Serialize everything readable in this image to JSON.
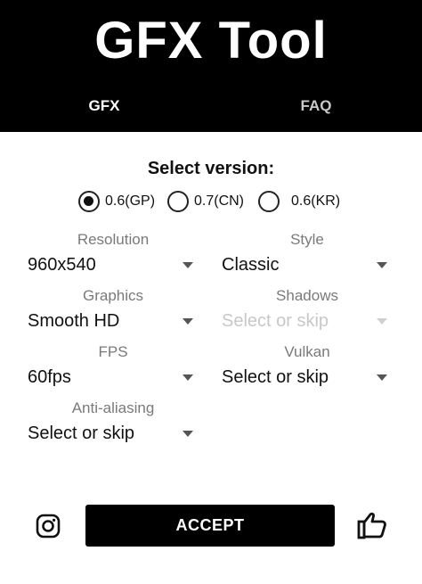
{
  "header": {
    "title": "GFX Tool",
    "tabs": [
      {
        "label": "GFX",
        "active": true
      },
      {
        "label": "FAQ",
        "active": false
      }
    ]
  },
  "version": {
    "heading": "Select version:",
    "options": [
      {
        "label": "0.6(GP)",
        "selected": true
      },
      {
        "label": "0.7(CN)",
        "selected": false
      },
      {
        "label": "0.6(KR)",
        "selected": false
      }
    ]
  },
  "settings": {
    "resolution": {
      "label": "Resolution",
      "value": "960x540"
    },
    "style": {
      "label": "Style",
      "value": "Classic"
    },
    "graphics": {
      "label": "Graphics",
      "value": "Smooth HD"
    },
    "shadows": {
      "label": "Shadows",
      "value": "Select or skip",
      "disabled": true
    },
    "fps": {
      "label": "FPS",
      "value": "60fps"
    },
    "vulkan": {
      "label": "Vulkan",
      "value": "Select or skip"
    },
    "antialiasing": {
      "label": "Anti-aliasing",
      "value": "Select or skip"
    }
  },
  "footer": {
    "accept_label": "ACCEPT",
    "left_icon": "instagram-icon",
    "right_icon": "thumbs-up-icon"
  },
  "colors": {
    "header_bg": "#000000",
    "active_tab": "#ffffff",
    "inactive_tab": "#c9c9c9",
    "field_label": "#7a7a7a",
    "disabled_text": "#c8c8c8"
  }
}
